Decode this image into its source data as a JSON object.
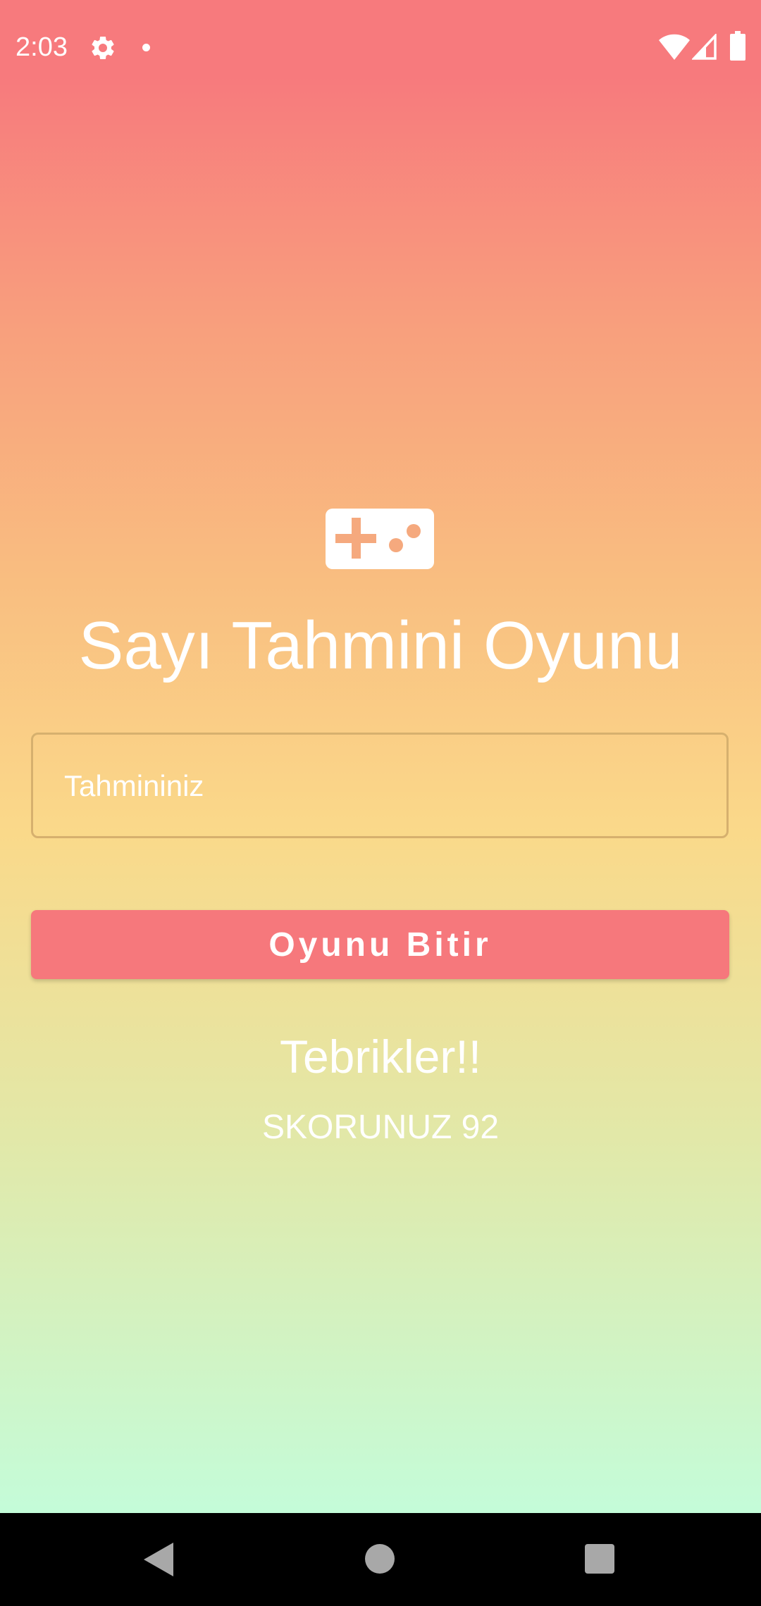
{
  "status_bar": {
    "time": "2:03",
    "icons": [
      "gear-icon",
      "notification-dot-icon",
      "wifi-icon",
      "signal-icon",
      "battery-icon"
    ]
  },
  "app": {
    "icon": "gamepad-icon",
    "title": "Sayı Tahmini Oyunu",
    "guess_input": {
      "placeholder": "Tahmininiz",
      "value": ""
    },
    "end_button_label": "Oyunu Bitir",
    "congrats_text": "Tebrikler!!",
    "score_text": "SKORUNUZ 92"
  },
  "nav_bar": {
    "icons": [
      "back-icon",
      "home-icon",
      "recents-icon"
    ]
  },
  "colors": {
    "gradient_top": "#f77a7d",
    "gradient_middle": "#fad98a",
    "gradient_bottom": "#c4fcd9",
    "button": "#f6787c",
    "input_border": "#d6b06e",
    "icon_accent": "#f5a97e"
  }
}
